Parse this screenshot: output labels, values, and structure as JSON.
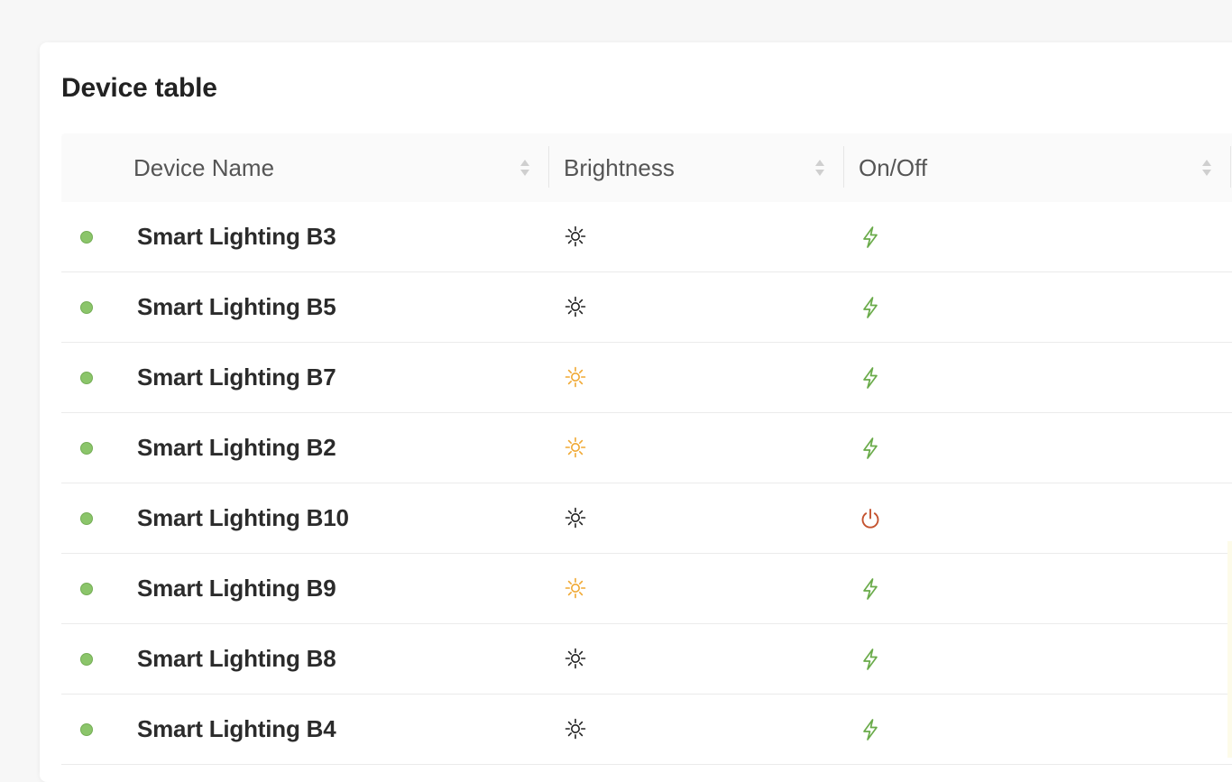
{
  "card": {
    "title": "Device table"
  },
  "table": {
    "columns": [
      {
        "label": "Device Name"
      },
      {
        "label": "Brightness"
      },
      {
        "label": "On/Off"
      }
    ],
    "rows": [
      {
        "name": "Smart Lighting B3",
        "status_color": "#8bc56a",
        "brightness_icon": "sun-dark-icon",
        "power_icon": "bolt-icon"
      },
      {
        "name": "Smart Lighting B5",
        "status_color": "#8bc56a",
        "brightness_icon": "sun-dark-icon",
        "power_icon": "bolt-icon"
      },
      {
        "name": "Smart Lighting B7",
        "status_color": "#8bc56a",
        "brightness_icon": "sun-bright-icon",
        "power_icon": "bolt-icon"
      },
      {
        "name": "Smart Lighting B2",
        "status_color": "#8bc56a",
        "brightness_icon": "sun-bright-icon",
        "power_icon": "bolt-icon"
      },
      {
        "name": "Smart Lighting B10",
        "status_color": "#8bc56a",
        "brightness_icon": "sun-dark-icon",
        "power_icon": "power-off-icon"
      },
      {
        "name": "Smart Lighting B9",
        "status_color": "#8bc56a",
        "brightness_icon": "sun-bright-icon",
        "power_icon": "bolt-icon"
      },
      {
        "name": "Smart Lighting B8",
        "status_color": "#8bc56a",
        "brightness_icon": "sun-dark-icon",
        "power_icon": "bolt-icon"
      },
      {
        "name": "Smart Lighting B4",
        "status_color": "#8bc56a",
        "brightness_icon": "sun-dark-icon",
        "power_icon": "bolt-icon"
      }
    ]
  },
  "colors": {
    "status_online": "#8bc56a",
    "sun_dark": "#222222",
    "sun_bright": "#f0a832",
    "bolt_green": "#6aab4a",
    "power_off_red": "#c4522e"
  }
}
